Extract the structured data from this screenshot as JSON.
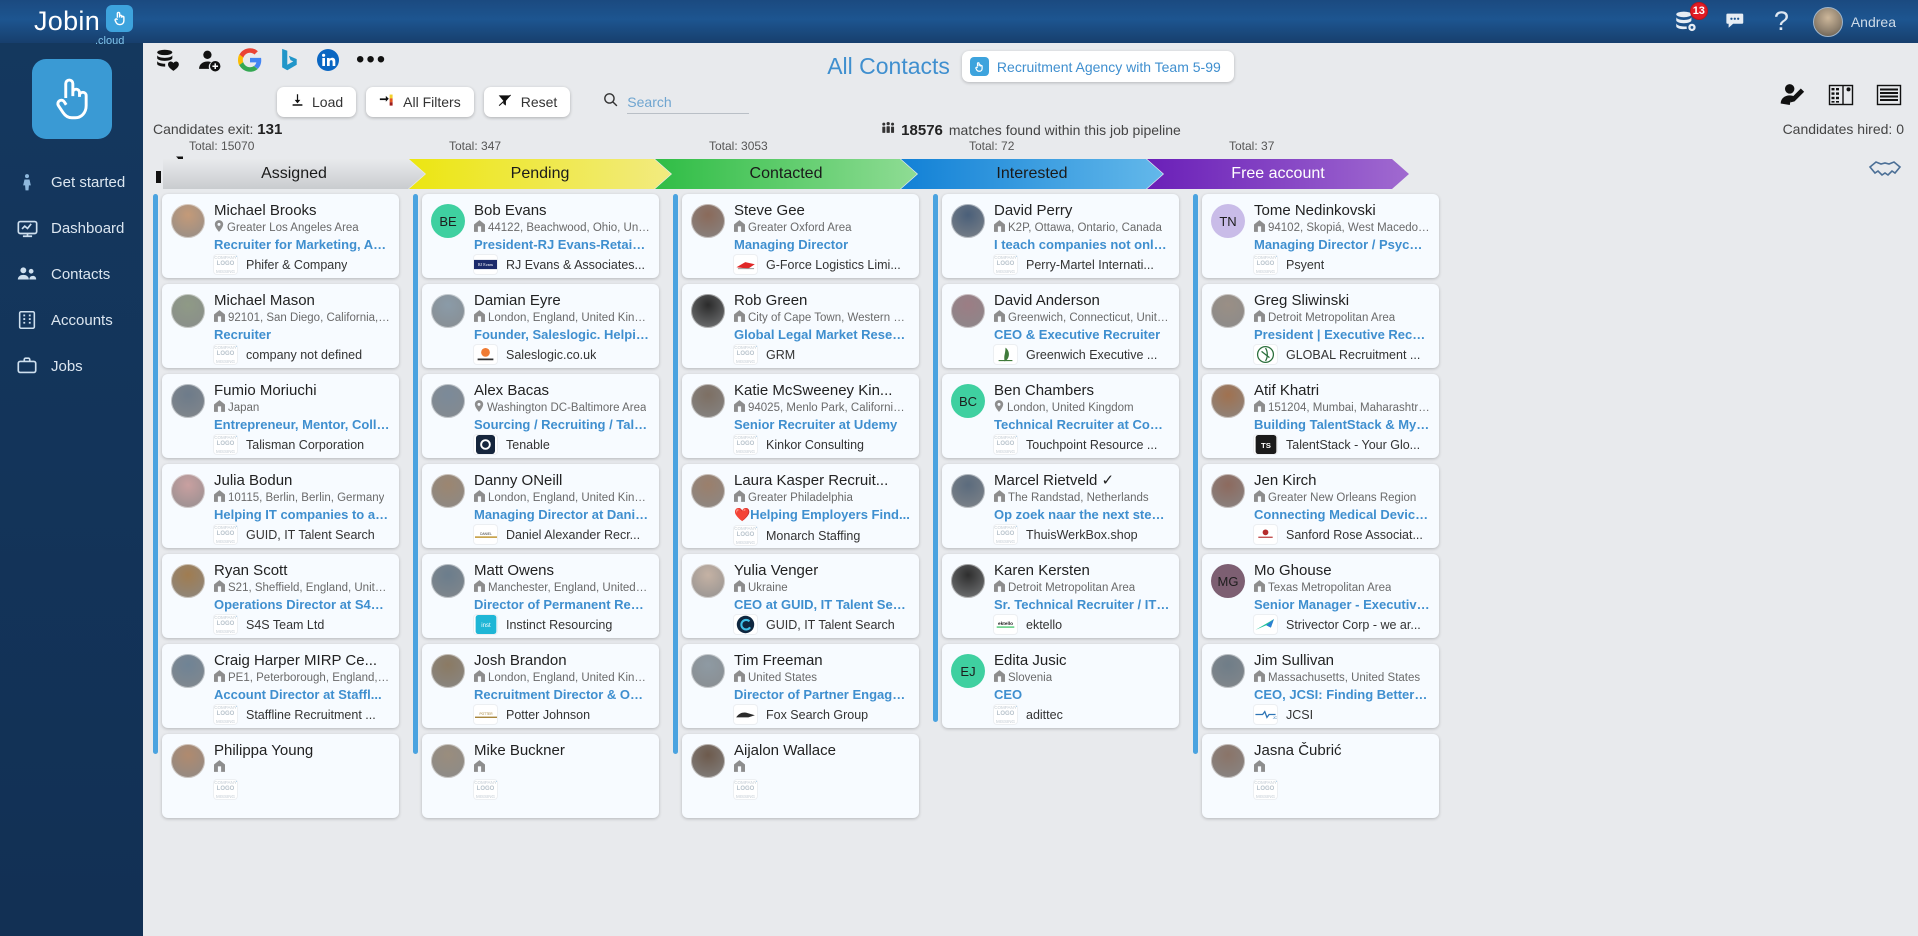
{
  "brand": {
    "name": "Jobin",
    "suffix": ".cloud",
    "badge_icon": "hand-pointer-icon"
  },
  "topbar": {
    "icons": [
      {
        "name": "database-settings-icon",
        "badge": "13"
      },
      {
        "name": "chat-icon"
      },
      {
        "name": "help-icon"
      }
    ],
    "user": {
      "name": "Andrea",
      "avatar_name": "user-avatar"
    }
  },
  "sidebar": {
    "items": [
      {
        "label": "Get started",
        "icon": "rocket-person-icon"
      },
      {
        "label": "Dashboard",
        "icon": "dashboard-icon"
      },
      {
        "label": "Contacts",
        "icon": "contacts-icon"
      },
      {
        "label": "Accounts",
        "icon": "accounts-building-icon"
      },
      {
        "label": "Jobs",
        "icon": "jobs-briefcase-icon"
      }
    ]
  },
  "sources": [
    {
      "name": "database-heart-icon"
    },
    {
      "name": "add-person-icon"
    },
    {
      "name": "google-icon"
    },
    {
      "name": "bing-icon"
    },
    {
      "name": "linkedin-icon"
    },
    {
      "name": "more-options-icon"
    }
  ],
  "header": {
    "title": "All Contacts",
    "team_chip": "Recruitment Agency with Team 5-99",
    "right_icons": [
      {
        "name": "edit-contact-icon"
      },
      {
        "name": "board-view-icon"
      },
      {
        "name": "list-view-icon"
      }
    ]
  },
  "toolbar": {
    "load_label": "Load",
    "all_filters_label": "All Filters",
    "reset_label": "Reset",
    "search_placeholder": "Search",
    "search_value": ""
  },
  "stats": {
    "exit_label": "Candidates exit:",
    "exit_value": "131",
    "matches_value": "18576",
    "matches_label": "matches found within this job pipeline",
    "hired_label": "Candidates hired:",
    "hired_value": "0"
  },
  "pipeline": {
    "total_prefix": "Total:",
    "stages": [
      {
        "label": "Assigned",
        "total": "15070",
        "color": "#d2d4d7",
        "text_color": "#1a1a1a"
      },
      {
        "label": "Pending",
        "total": "347",
        "color": "#eee11f",
        "text_color": "#1a1a1a"
      },
      {
        "label": "Contacted",
        "total": "3053",
        "color": "#41c351",
        "text_color": "#1a1a1a"
      },
      {
        "label": "Interested",
        "total": "72",
        "color": "#1a8fe0",
        "text_color": "#1a1a1a"
      },
      {
        "label": "Free account",
        "total": "37",
        "color": "#7a2fc4",
        "text_color": "#ffffff"
      }
    ],
    "columns": [
      {
        "stage": "Assigned",
        "cards": [
          {
            "name": "Michael Brooks",
            "loc": "Greater Los Angeles Area",
            "loc_icon": "pin-icon",
            "title": "Recruiter for Marketing, Ad...",
            "company": "Phifer & Company",
            "logo": "missing",
            "avatar_type": "photo",
            "avatar_color": "#c49a78"
          },
          {
            "name": "Michael Mason",
            "loc": "92101, San Diego, California, U...",
            "loc_icon": "home-icon",
            "title": "Recruiter",
            "company": "company not defined",
            "logo": "missing",
            "avatar_type": "photo",
            "avatar_color": "#8f9a86"
          },
          {
            "name": "Fumio Moriuchi",
            "loc": "Japan",
            "loc_icon": "home-icon",
            "title": "Entrepreneur, Mentor, Colla...",
            "company": "Talisman Corporation",
            "logo": "missing",
            "avatar_type": "photo",
            "avatar_color": "#6d7b8a"
          },
          {
            "name": "Julia Bodun",
            "loc": "10115, Berlin, Berlin, Germany",
            "loc_icon": "home-icon",
            "title": "Helping IT companies to ac...",
            "company": "GUID, IT Talent Search",
            "logo": "missing",
            "avatar_type": "photo",
            "avatar_color": "#c9a0a0"
          },
          {
            "name": "Ryan Scott",
            "loc": "S21, Sheffield, England, United ...",
            "loc_icon": "home-icon",
            "title": "Operations Director at S4S ...",
            "company": "S4S Team Ltd",
            "logo": "missing",
            "avatar_type": "photo",
            "avatar_color": "#a07c50"
          },
          {
            "name": "Craig Harper MIRP Ce...",
            "loc": "PE1, Peterborough, England, U...",
            "loc_icon": "home-icon",
            "title": "Account Director at Staffl...",
            "company": "Staffline Recruitment ...",
            "logo": "missing",
            "avatar_type": "photo",
            "avatar_color": "#6f8395"
          },
          {
            "name": "Philippa Young",
            "loc": "",
            "loc_icon": "home-icon",
            "title": "",
            "company": "",
            "logo": "missing",
            "avatar_type": "photo",
            "avatar_color": "#b08a6e"
          }
        ]
      },
      {
        "stage": "Pending",
        "cards": [
          {
            "name": "Bob Evans",
            "loc": "44122, Beachwood, Ohio, Unite...",
            "loc_icon": "home-icon",
            "title": "President-RJ Evans-Retaine...",
            "company": "RJ Evans & Associates...",
            "logo": "rj-evans",
            "avatar_type": "initials",
            "initials": "BE",
            "avatar_color": "#3fd0a0"
          },
          {
            "name": "Damian Eyre",
            "loc": "London, England, United Kingd...",
            "loc_icon": "home-icon",
            "title": "Founder, Saleslogic. Helpin...",
            "company": "Saleslogic.co.uk",
            "logo": "saleslogic",
            "avatar_type": "photo",
            "avatar_color": "#8a9ba8"
          },
          {
            "name": "Alex Bacas",
            "loc": "Washington DC-Baltimore Area",
            "loc_icon": "pin-icon",
            "title": "Sourcing / Recruiting / Tale...",
            "company": "Tenable",
            "logo": "tenable",
            "avatar_type": "photo",
            "avatar_color": "#7b8a99"
          },
          {
            "name": "Danny ONeill",
            "loc": "London, England, United Kingd...",
            "loc_icon": "home-icon",
            "title": "Managing Director at Danie...",
            "company": "Daniel Alexander Recr...",
            "logo": "daniel",
            "avatar_type": "photo",
            "avatar_color": "#9c8670"
          },
          {
            "name": "Matt Owens",
            "loc": "Manchester, England, United Ki...",
            "loc_icon": "home-icon",
            "title": "Director of Permanent Recr...",
            "company": "Instinct Resourcing",
            "logo": "instinct",
            "avatar_type": "photo",
            "avatar_color": "#6b7d8c"
          },
          {
            "name": "Josh Brandon",
            "loc": "London, England, United Kingd...",
            "loc_icon": "home-icon",
            "title": "Recruitment Director & Ow...",
            "company": "Potter Johnson",
            "logo": "potter",
            "avatar_type": "photo",
            "avatar_color": "#8b7a63"
          },
          {
            "name": "Mike Buckner",
            "loc": "",
            "loc_icon": "home-icon",
            "title": "",
            "company": "",
            "logo": "missing",
            "avatar_type": "photo",
            "avatar_color": "#9a8d7d"
          }
        ]
      },
      {
        "stage": "Contacted",
        "cards": [
          {
            "name": "Steve Gee",
            "loc": "Greater Oxford Area",
            "loc_icon": "home-icon",
            "title": "Managing Director",
            "company": "G-Force Logistics Limi...",
            "logo": "gforce",
            "avatar_type": "photo",
            "avatar_color": "#8a6a5a"
          },
          {
            "name": "Rob Green",
            "loc": "City of Cape Town, Western Ca...",
            "loc_icon": "home-icon",
            "title": "Global Legal Market Resear...",
            "company": "GRM",
            "logo": "missing",
            "avatar_type": "photo",
            "avatar_color": "#2b2b2b"
          },
          {
            "name": "Katie McSweeney Kin...",
            "loc": "94025, Menlo Park, California, ...",
            "loc_icon": "home-icon",
            "title": "Senior Recruiter at Udemy",
            "company": "Kinkor Consulting",
            "logo": "missing",
            "avatar_type": "photo",
            "avatar_color": "#7d6f63"
          },
          {
            "name": "Laura Kasper Recruit...",
            "loc": "Greater Philadelphia",
            "loc_icon": "home-icon",
            "title": "❤️Helping Employers Find...",
            "company": "Monarch Staffing",
            "logo": "missing",
            "avatar_type": "photo",
            "avatar_color": "#9b7f6b"
          },
          {
            "name": "Yulia Venger",
            "loc": "Ukraine",
            "loc_icon": "home-icon",
            "title": "CEO at GUID, IT Talent Sear...",
            "company": "GUID, IT Talent Search",
            "logo": "guid",
            "avatar_type": "photo",
            "avatar_color": "#c5b2a4"
          },
          {
            "name": "Tim Freeman",
            "loc": "United States",
            "loc_icon": "home-icon",
            "title": "Director of Partner Engage...",
            "company": "Fox Search Group",
            "logo": "fox",
            "avatar_type": "photo",
            "avatar_color": "#8e9aa3"
          },
          {
            "name": "Aijalon Wallace",
            "loc": "",
            "loc_icon": "home-icon",
            "title": "",
            "company": "",
            "logo": "missing",
            "avatar_type": "photo",
            "avatar_color": "#6d5a4c"
          }
        ]
      },
      {
        "stage": "Interested",
        "cards": [
          {
            "name": "David Perry",
            "loc": "K2P, Ottawa, Ontario, Canada",
            "loc_icon": "home-icon",
            "title": "I teach companies not only ...",
            "company": "Perry-Martel Internati...",
            "logo": "missing",
            "avatar_type": "photo",
            "avatar_color": "#4a5f79"
          },
          {
            "name": "David Anderson",
            "loc": "Greenwich, Connecticut, Unite...",
            "loc_icon": "home-icon",
            "title": "CEO & Executive Recruiter",
            "company": "Greenwich Executive ...",
            "logo": "greenwich",
            "avatar_type": "photo",
            "avatar_color": "#9c7d84"
          },
          {
            "name": "Ben Chambers",
            "loc": "London, United Kingdom",
            "loc_icon": "pin-icon",
            "title": "Technical Recruiter at Cont...",
            "company": "Touchpoint Resource ...",
            "logo": "missing",
            "avatar_type": "initials",
            "initials": "BC",
            "avatar_color": "#3fd0a0"
          },
          {
            "name": "Marcel Rietveld ✓",
            "loc": "The Randstad, Netherlands",
            "loc_icon": "home-icon",
            "title": "Op zoek naar the next step i...",
            "company": "ThuisWerkBox.shop",
            "logo": "missing",
            "avatar_type": "photo",
            "avatar_color": "#5b6b7d"
          },
          {
            "name": "Karen Kersten",
            "loc": "Detroit Metropolitan Area",
            "loc_icon": "home-icon",
            "title": "Sr. Technical Recruiter / IT ...",
            "company": "ektello",
            "logo": "ektello",
            "avatar_type": "photo",
            "avatar_color": "#2e2e2e"
          },
          {
            "name": "Edita Jusic",
            "loc": "Slovenia",
            "loc_icon": "home-icon",
            "title": "CEO",
            "company": "adittec",
            "logo": "missing",
            "avatar_type": "initials",
            "initials": "EJ",
            "avatar_color": "#3fd0a0"
          }
        ]
      },
      {
        "stage": "Free account",
        "cards": [
          {
            "name": "Tome Nedinkovski",
            "loc": "94102, Skopiá, West Macedonia...",
            "loc_icon": "home-icon",
            "title": "Managing Director / Psycho...",
            "company": "Psyent",
            "logo": "missing",
            "avatar_type": "initials",
            "initials": "TN",
            "avatar_color": "#c9bce8"
          },
          {
            "name": "Greg Sliwinski",
            "loc": "Detroit Metropolitan Area",
            "loc_icon": "home-icon",
            "title": "President | Executive Recrui...",
            "company": "GLOBAL Recruitment ...",
            "logo": "global",
            "avatar_type": "photo",
            "avatar_color": "#9a8f85"
          },
          {
            "name": "Atif Khatri",
            "loc": "151204, Mumbai, Maharashtra, ...",
            "loc_icon": "home-icon",
            "title": "Building TalentStack & MyP...",
            "company": "TalentStack - Your Glo...",
            "logo": "talentstack",
            "avatar_type": "photo",
            "avatar_color": "#a0714f"
          },
          {
            "name": "Jen Kirch",
            "loc": "Greater New Orleans Region",
            "loc_icon": "home-icon",
            "title": "Connecting Medical Device ...",
            "company": "Sanford Rose Associat...",
            "logo": "sanford",
            "avatar_type": "photo",
            "avatar_color": "#8d6a5e"
          },
          {
            "name": "Mo Ghouse",
            "loc": "Texas Metropolitan Area",
            "loc_icon": "home-icon",
            "title": "Senior Manager - Executive ...",
            "company": "Strivector Corp - we ar...",
            "logo": "strivector",
            "avatar_type": "initials",
            "initials": "MG",
            "avatar_color": "#7d5f72"
          },
          {
            "name": "Jim Sullivan",
            "loc": "Massachusetts, United States",
            "loc_icon": "home-icon",
            "title": "CEO, JCSI: Finding Better C...",
            "company": "JCSI",
            "logo": "jcsi",
            "avatar_type": "photo",
            "avatar_color": "#6f7d88"
          },
          {
            "name": "Jasna Čubrić",
            "loc": "",
            "loc_icon": "home-icon",
            "title": "",
            "company": "",
            "logo": "missing",
            "avatar_type": "photo",
            "avatar_color": "#8a7468"
          }
        ]
      }
    ]
  }
}
